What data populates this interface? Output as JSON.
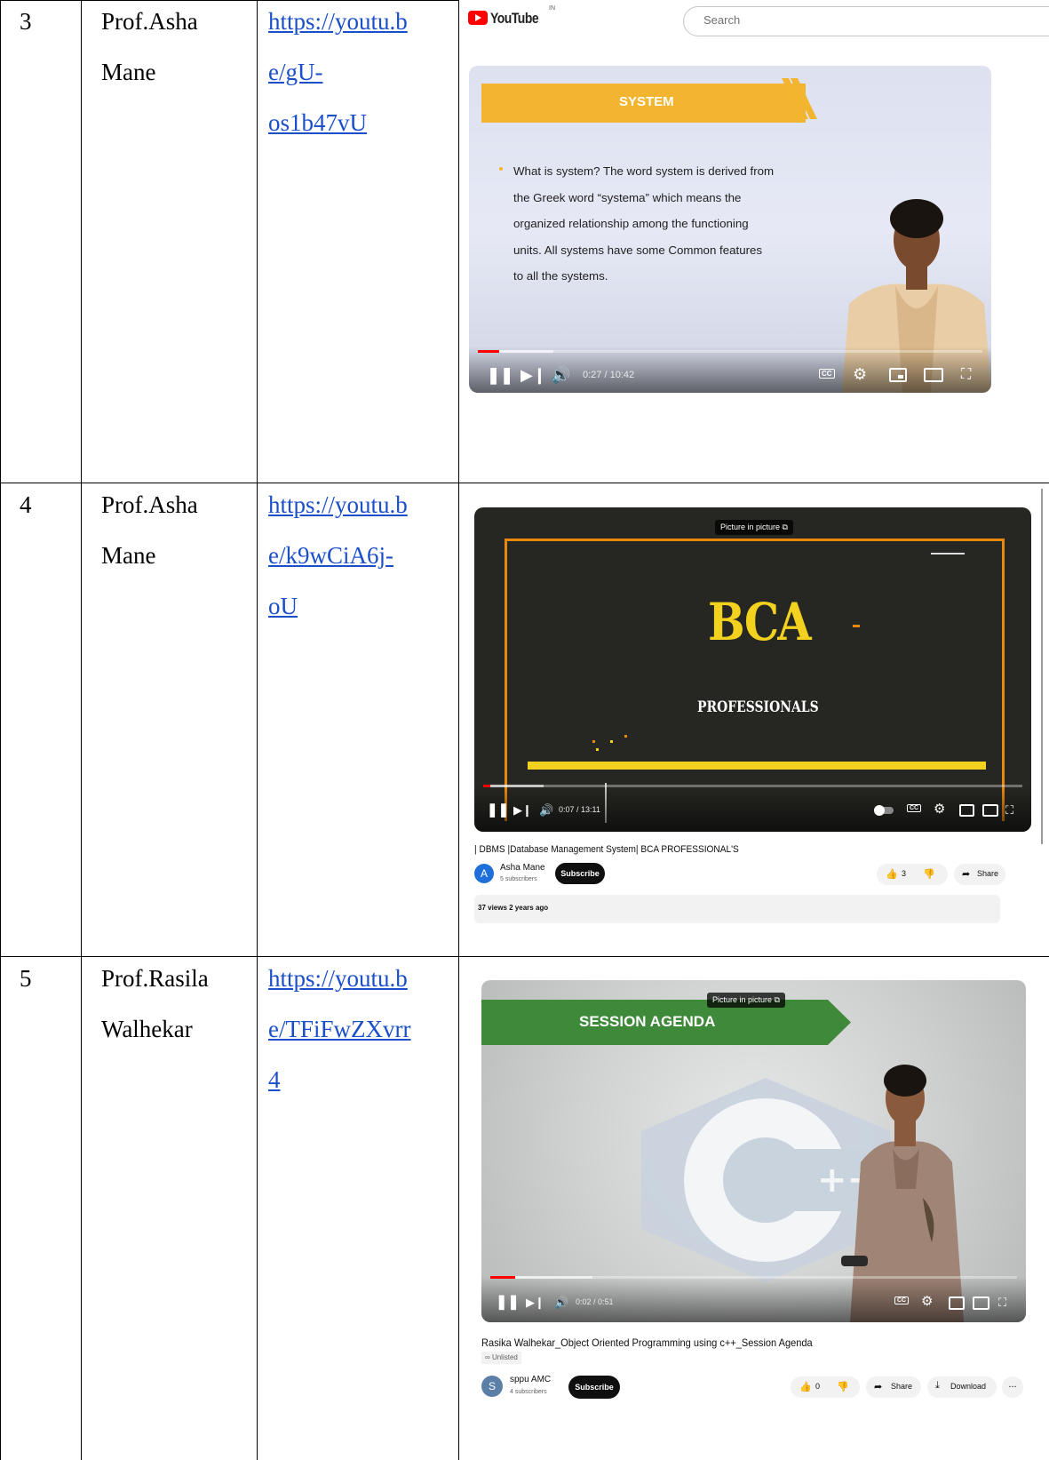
{
  "rows": [
    {
      "num": "3",
      "name_line1": "Prof.Asha",
      "name_line2": "Mane",
      "link_line1": "https://youtu.b",
      "link_line2": "e/gU-",
      "link_line3": "os1b47vU",
      "screenshot": {
        "yt_logo": "YouTube",
        "yt_region": "IN",
        "search_placeholder": "Search",
        "slide_title": "SYSTEM",
        "slide_text_lines": [
          "What is system? The word system is derived from",
          "the Greek word “systema” which means the",
          "organized relationship among the functioning",
          "units. All  systems have some Common features",
          "to all the systems."
        ],
        "time": "0:27 / 10:42",
        "progress": 0.04,
        "cc": "CC"
      }
    },
    {
      "num": "4",
      "name_line1": "Prof.Asha",
      "name_line2": "Mane",
      "link_line1": "https://youtu.b",
      "link_line2": "e/k9wCiA6j-",
      "link_line3": "oU",
      "screenshot": {
        "pip_label": "Picture in picture",
        "big_title": "BCA",
        "sub_title": "PROFESSIONALS",
        "time": "0:07 / 13:11",
        "progress": 0.01,
        "cc": "CC",
        "video_title": "| DBMS |Database Management System| BCA PROFESSIONAL'S",
        "channel_initial": "A",
        "channel_name": "Asha Mane",
        "subscribers": "5 subscribers",
        "subscribe_label": "Subscribe",
        "likes": "3",
        "share_label": "Share",
        "views_line": "37 views  2 years ago"
      }
    },
    {
      "num": "5",
      "name_line1": "Prof.Rasila",
      "name_line2": "Walhekar",
      "link_line1": "https://youtu.b",
      "link_line2": "e/TFiFwZXvrr",
      "link_line3": "4",
      "screenshot": {
        "pip_label": "Picture in picture",
        "banner_text": "SESSION AGENDA",
        "logo_text": "C++",
        "time": "0:02 / 0:51",
        "progress": 0.05,
        "cc": "CC",
        "video_title": "Rasika Walhekar_Object Oriented Programming using c++_Session Agenda",
        "unlisted_label": "Unlisted",
        "channel_initial": "S",
        "channel_name": "sppu AMC",
        "subscribers": "4 subscribers",
        "subscribe_label": "Subscribe",
        "likes": "0",
        "share_label": "Share",
        "download_label": "Download",
        "more_label": "..."
      }
    }
  ],
  "colors": {
    "link": "#1a4fc9",
    "yt_red": "#ff0000",
    "slide_yellow": "#f3b52f",
    "bca_yellow": "#f2d21e",
    "bca_orange": "#e8890c",
    "agenda_green": "#3f8a3a"
  },
  "icons": [
    "play-logo-icon",
    "pause-icon",
    "next-icon",
    "volume-icon",
    "cc-icon",
    "settings-icon",
    "miniplayer-icon",
    "theater-icon",
    "fullscreen-icon",
    "pip-icon",
    "like-icon",
    "dislike-icon",
    "share-icon",
    "download-icon",
    "unlisted-icon"
  ]
}
